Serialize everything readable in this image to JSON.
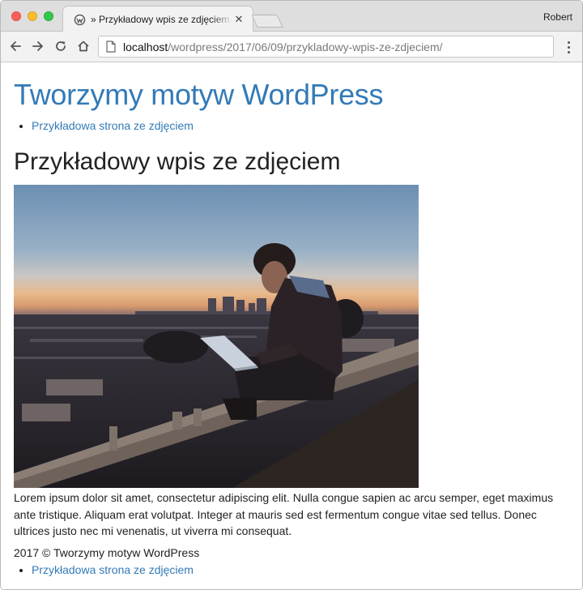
{
  "browser": {
    "tab_title": "» Przykładowy wpis ze zdjęciem",
    "profile_name": "Robert",
    "url_host": "localhost",
    "url_path": "/wordpress/2017/06/09/przykladowy-wpis-ze-zdjeciem/",
    "icons": [
      "back-arrow-icon",
      "forward-arrow-icon",
      "reload-icon",
      "home-icon",
      "page-icon",
      "more-menu-icon",
      "close-icon",
      "wordpress-icon"
    ]
  },
  "site": {
    "title": "Tworzymy motyw WordPress",
    "menu": [
      "Przykładowa strona ze zdjęciem"
    ]
  },
  "post": {
    "title": "Przykładowy wpis ze zdjęciem",
    "body": "Lorem ipsum dolor sit amet, consectetur adipiscing elit. Nulla congue sapien ac arcu semper, eget maximus ante tristique. Aliquam erat volutpat. Integer at mauris sed est fermentum congue vitae sed tellus. Donec ultrices justo nec mi venenatis, ut viverra mi consequat."
  },
  "footer": {
    "copyright": "2017 © Tworzymy motyw WordPress",
    "menu": [
      "Przykładowa strona ze zdjęciem"
    ]
  },
  "colors": {
    "link": "#337ab7",
    "text": "#222222"
  }
}
